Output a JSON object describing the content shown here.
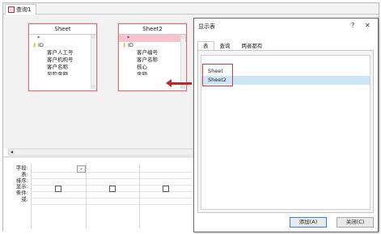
{
  "document_tab": {
    "label": "查询1"
  },
  "tables": [
    {
      "title": "Sheet",
      "fields": [
        "*",
        "ID",
        "客户人工号",
        "客户机构号",
        "客户名称",
        "风险金额"
      ]
    },
    {
      "title": "Sheet2",
      "fields": [
        "*",
        "ID",
        "客户编号",
        "客户名称",
        "核心",
        "金额"
      ]
    }
  ],
  "grid": {
    "row_labels": [
      "字段:",
      "表:",
      "排序:",
      "显示:",
      "条件:",
      "或:"
    ]
  },
  "dialog": {
    "title": "显示表",
    "help": "?",
    "close": "✕",
    "tabs": [
      "表",
      "查询",
      "两者都有"
    ],
    "items": [
      "Sheet",
      "Sheet2"
    ],
    "add_label": "添加(A)",
    "close_label": "关闭(C)"
  },
  "colors": {
    "accent": "#c2242f",
    "selection": "#cde6f7"
  }
}
